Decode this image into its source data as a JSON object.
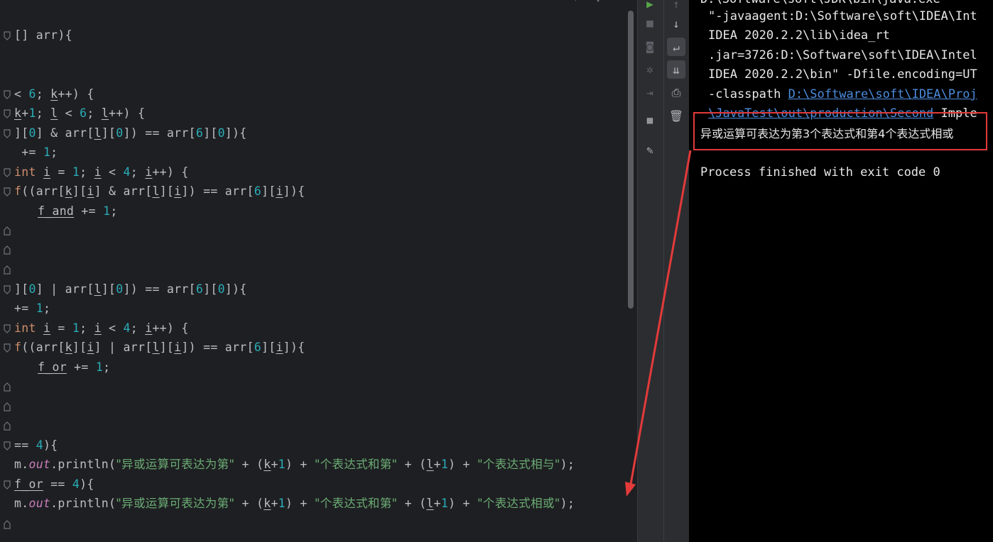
{
  "editor": {
    "lines": {
      "l1": "[] arr){",
      "l2_a": "< ",
      "l2_b": "6",
      "l2_c": "; ",
      "l2_k": "k",
      "l2_d": "++) {",
      "l3_k": "k",
      "l3_a": "+",
      "l3_b": "1",
      "l3_c": "; ",
      "l3_l": "l",
      "l3_d": " < ",
      "l3_e": "6",
      "l3_f": "; ",
      "l3_l2": "l",
      "l3_g": "++) {",
      "l4_a": "][",
      "l4_b": "0",
      "l4_c": "] & arr[",
      "l4_l": "l",
      "l4_d": "][",
      "l4_e": "0",
      "l4_f": "]) == arr[",
      "l4_g": "6",
      "l4_h": "][",
      "l4_i": "0",
      "l4_j": "]){",
      "l5_a": " += ",
      "l5_b": "1",
      "l5_c": ";",
      "l6_int": "int ",
      "l6_i": "i",
      "l6_a": " = ",
      "l6_b": "1",
      "l6_c": "; ",
      "l6_i2": "i",
      "l6_d": " < ",
      "l6_e": "4",
      "l6_f": "; ",
      "l6_i3": "i",
      "l6_g": "++) {",
      "l7_f": "f",
      "l7_a": "((arr[",
      "l7_k": "k",
      "l7_b": "][",
      "l7_i": "i",
      "l7_c": "] & arr[",
      "l7_l": "l",
      "l7_d": "][",
      "l7_i2": "i",
      "l7_e": "]) == arr[",
      "l7_g": "6",
      "l7_h": "][",
      "l7_i3": "i",
      "l7_j": "]){",
      "l8_var": "f_and",
      "l8_a": " += ",
      "l8_b": "1",
      "l8_c": ";",
      "l9_a": "][",
      "l9_b": "0",
      "l9_c": "] | arr[",
      "l9_l": "l",
      "l9_d": "][",
      "l9_e": "0",
      "l9_f": "]) == arr[",
      "l9_g": "6",
      "l9_h": "][",
      "l9_i": "0",
      "l9_j": "]){",
      "l10_a": "+= ",
      "l10_b": "1",
      "l10_c": ";",
      "l11_int": "int ",
      "l11_i": "i",
      "l11_a": " = ",
      "l11_b": "1",
      "l11_c": "; ",
      "l11_i2": "i",
      "l11_d": " < ",
      "l11_e": "4",
      "l11_f": "; ",
      "l11_i3": "i",
      "l11_g": "++) {",
      "l12_f": "f",
      "l12_a": "((arr[",
      "l12_k": "k",
      "l12_b": "][",
      "l12_i": "i",
      "l12_c": "] | arr[",
      "l12_l": "l",
      "l12_d": "][",
      "l12_i2": "i",
      "l12_e": "]) == arr[",
      "l12_g": "6",
      "l12_h": "][",
      "l12_i3": "i",
      "l12_j": "]){",
      "l13_var": "f_or",
      "l13_a": " += ",
      "l13_b": "1",
      "l13_c": ";",
      "l14_a": "== ",
      "l14_b": "4",
      "l14_c": "){",
      "l15_a": "m.",
      "l15_out": "out",
      "l15_b": ".println(",
      "l15_s1": "\"异或运算可表达为第\"",
      "l15_c": " + (",
      "l15_k": "k",
      "l15_d": "+",
      "l15_e": "1",
      "l15_f": ") + ",
      "l15_s2": "\"个表达式和第\"",
      "l15_g": " + (",
      "l15_l": "l",
      "l15_h": "+",
      "l15_i": "1",
      "l15_j": ") + ",
      "l15_s3": "\"个表达式相与\"",
      "l15_end": ");",
      "l16_var": "f_or",
      "l16_a": " == ",
      "l16_b": "4",
      "l16_c": "){",
      "l17_a": "m.",
      "l17_out": "out",
      "l17_b": ".println(",
      "l17_s1": "\"异或运算可表达为第\"",
      "l17_c": " + (",
      "l17_k": "k",
      "l17_d": "+",
      "l17_e": "1",
      "l17_f": ") + ",
      "l17_s2": "\"个表达式和第\"",
      "l17_g": " + (",
      "l17_l": "l",
      "l17_h": "+",
      "l17_i": "1",
      "l17_j": ") + ",
      "l17_s3": "\"个表达式相或\"",
      "l17_end": ");"
    }
  },
  "toolbar": {
    "run_icon": "play-icon",
    "stop_icon": "stop-icon",
    "camera_icon": "camera-icon",
    "debug_icon": "bug-icon",
    "login_icon": "import-icon",
    "layout_icon": "layout-icon",
    "pin_icon": "pin-icon",
    "up_icon": "arrow-up-icon",
    "down_icon": "arrow-down-icon",
    "wrap_icon": "soft-wrap-icon",
    "scroll_end_icon": "scroll-to-end-icon",
    "print_icon": "print-icon",
    "trash_icon": "trash-icon"
  },
  "console": {
    "line0": "D:\\Software\\soft\\JDK\\bin\\java.exe",
    "line1": "\"-javaagent:D:\\Software\\soft\\IDEA\\Int",
    "line2": "IDEA 2020.2.2\\lib\\idea_rt",
    "line3": ".jar=3726:D:\\Software\\soft\\IDEA\\Intel",
    "line4": "IDEA 2020.2.2\\bin\" -Dfile.encoding=UT",
    "line5_a": "-classpath ",
    "line5_link": "D:\\Software\\soft\\IDEA\\Proj",
    "line6_link": "\\JavaTest\\out\\production\\Second",
    "line6_b": " Imple",
    "output": "异或运算可表达为第3个表达式和第4个表达式相或",
    "exit": "Process finished with exit code 0"
  },
  "colors": {
    "highlight_box": "#e23a3a",
    "arrow": "#e23a3a"
  }
}
